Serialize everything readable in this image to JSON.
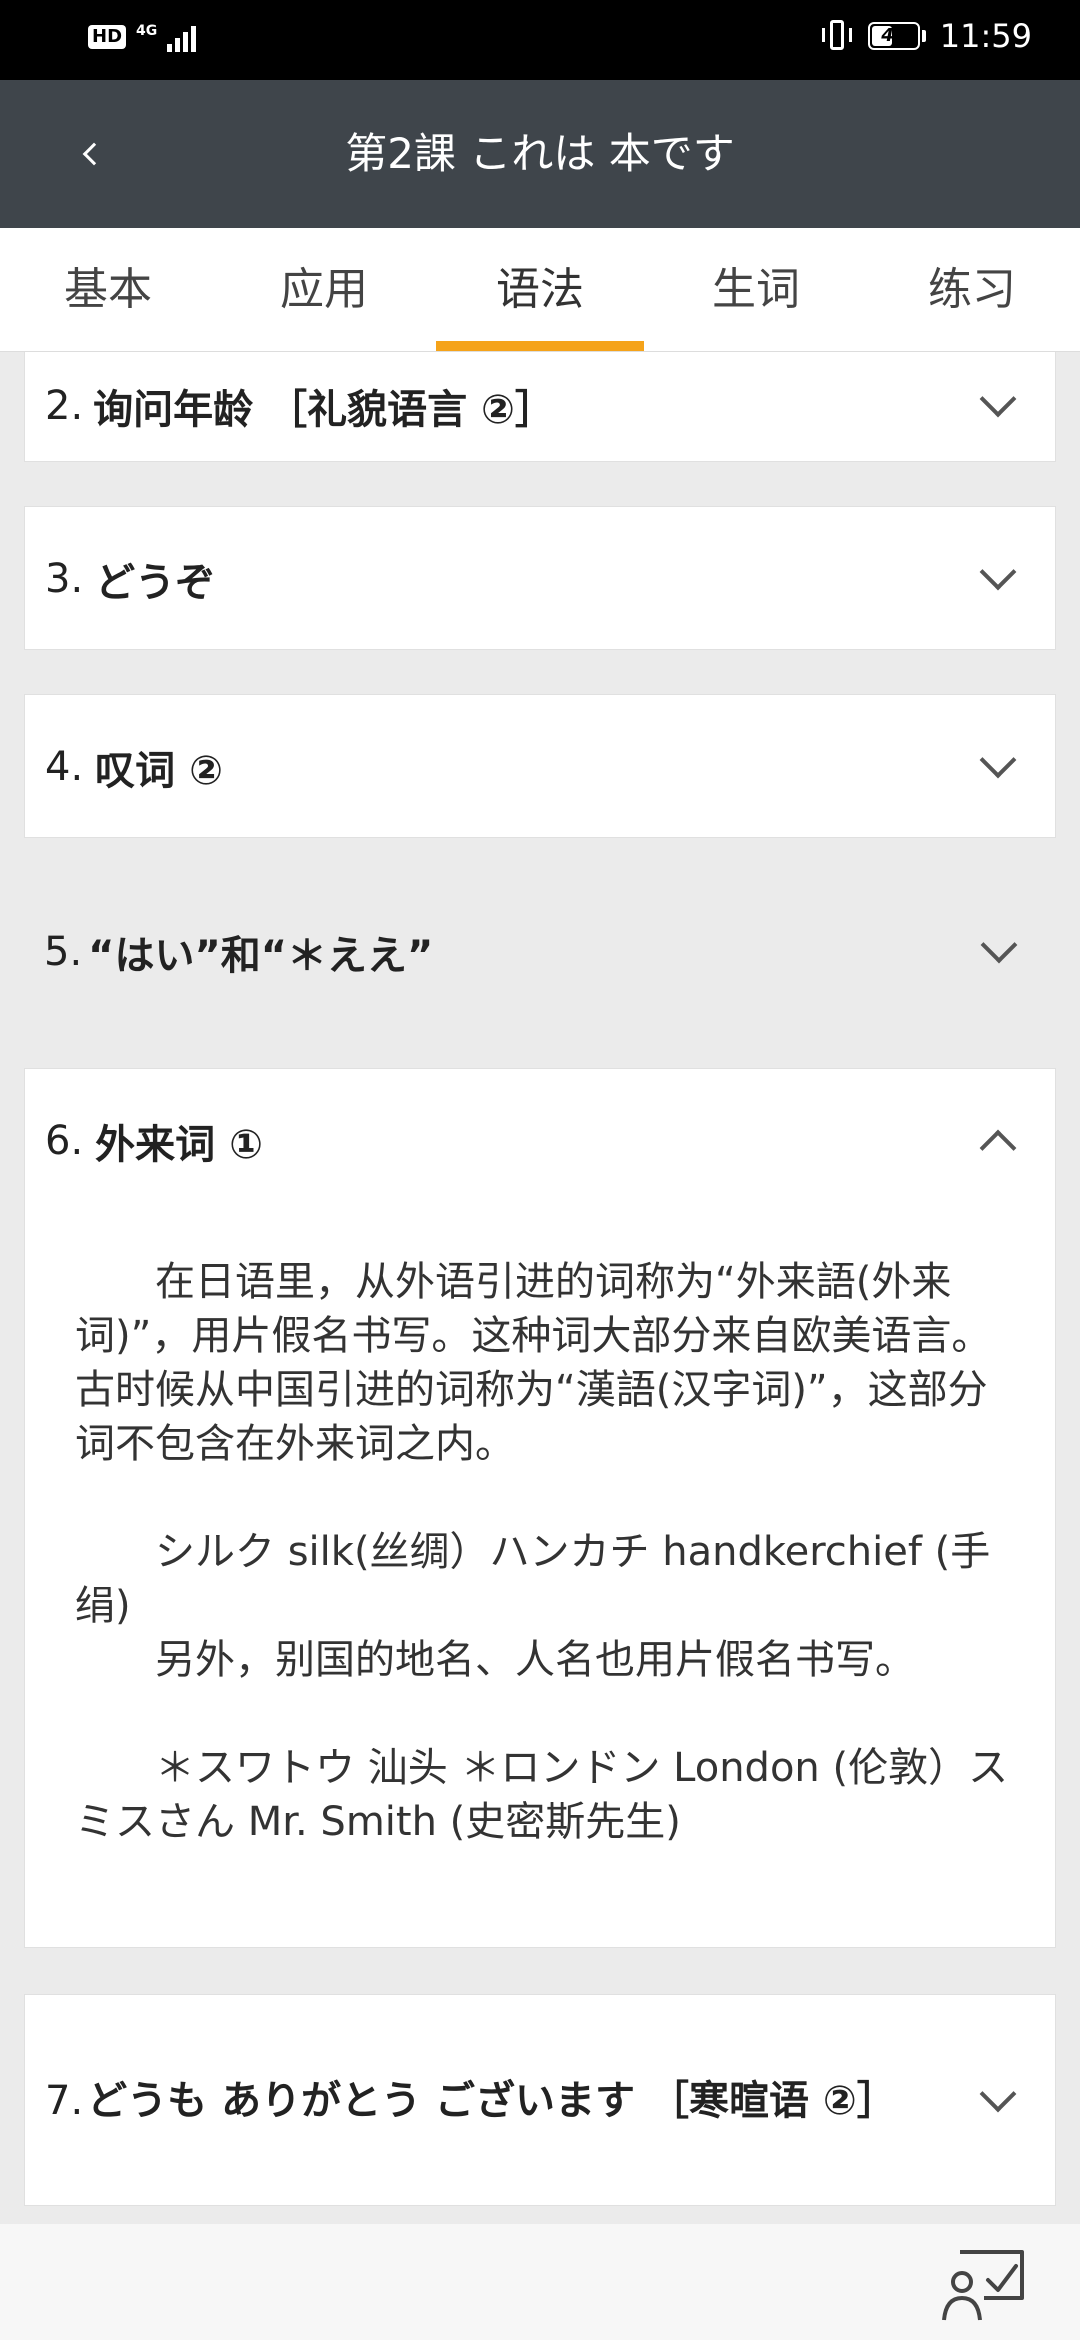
{
  "status": {
    "hd": "HD",
    "network": "4G",
    "battery": "46",
    "time": "11:59"
  },
  "header": {
    "title": "第2課 これは 本です"
  },
  "tabs": [
    "基本",
    "应用",
    "语法",
    "生词",
    "练习"
  ],
  "active_tab": "语法",
  "items": [
    {
      "num": "2.",
      "title": "询问年龄 ［礼貌语言 ②］"
    },
    {
      "num": "3.",
      "title": "どうぞ"
    },
    {
      "num": "4.",
      "title": "叹词 ②"
    },
    {
      "num": "5.",
      "title": "“はい”和“＊ええ”"
    },
    {
      "num": "6.",
      "title": "外来词 ①"
    },
    {
      "num": "7.",
      "title": "どうも ありがとう ございます ［寒暄语 ②］"
    }
  ],
  "expanded": {
    "p1": "在日语里，从外语引进的词称为“外来語(外来词)”，用片假名书写。这种词大部分来自欧美语言。古时候从中国引进的词称为“漢語(汉字词)”，这部分词不包含在外来词之内。",
    "p2": "シルク silk(丝绸）ハンカチ handkerchief (手绢)",
    "p3": "另外，别国的地名、人名也用片假名书写。",
    "p4": "＊スワトウ 汕头 ＊ロンドン London (伦敦）スミスさん Mr. Smith (史密斯先生)"
  },
  "colors": {
    "header_bg": "#3f454b",
    "tab_indicator": "#f5a31a",
    "page_bg": "#ebebeb"
  }
}
